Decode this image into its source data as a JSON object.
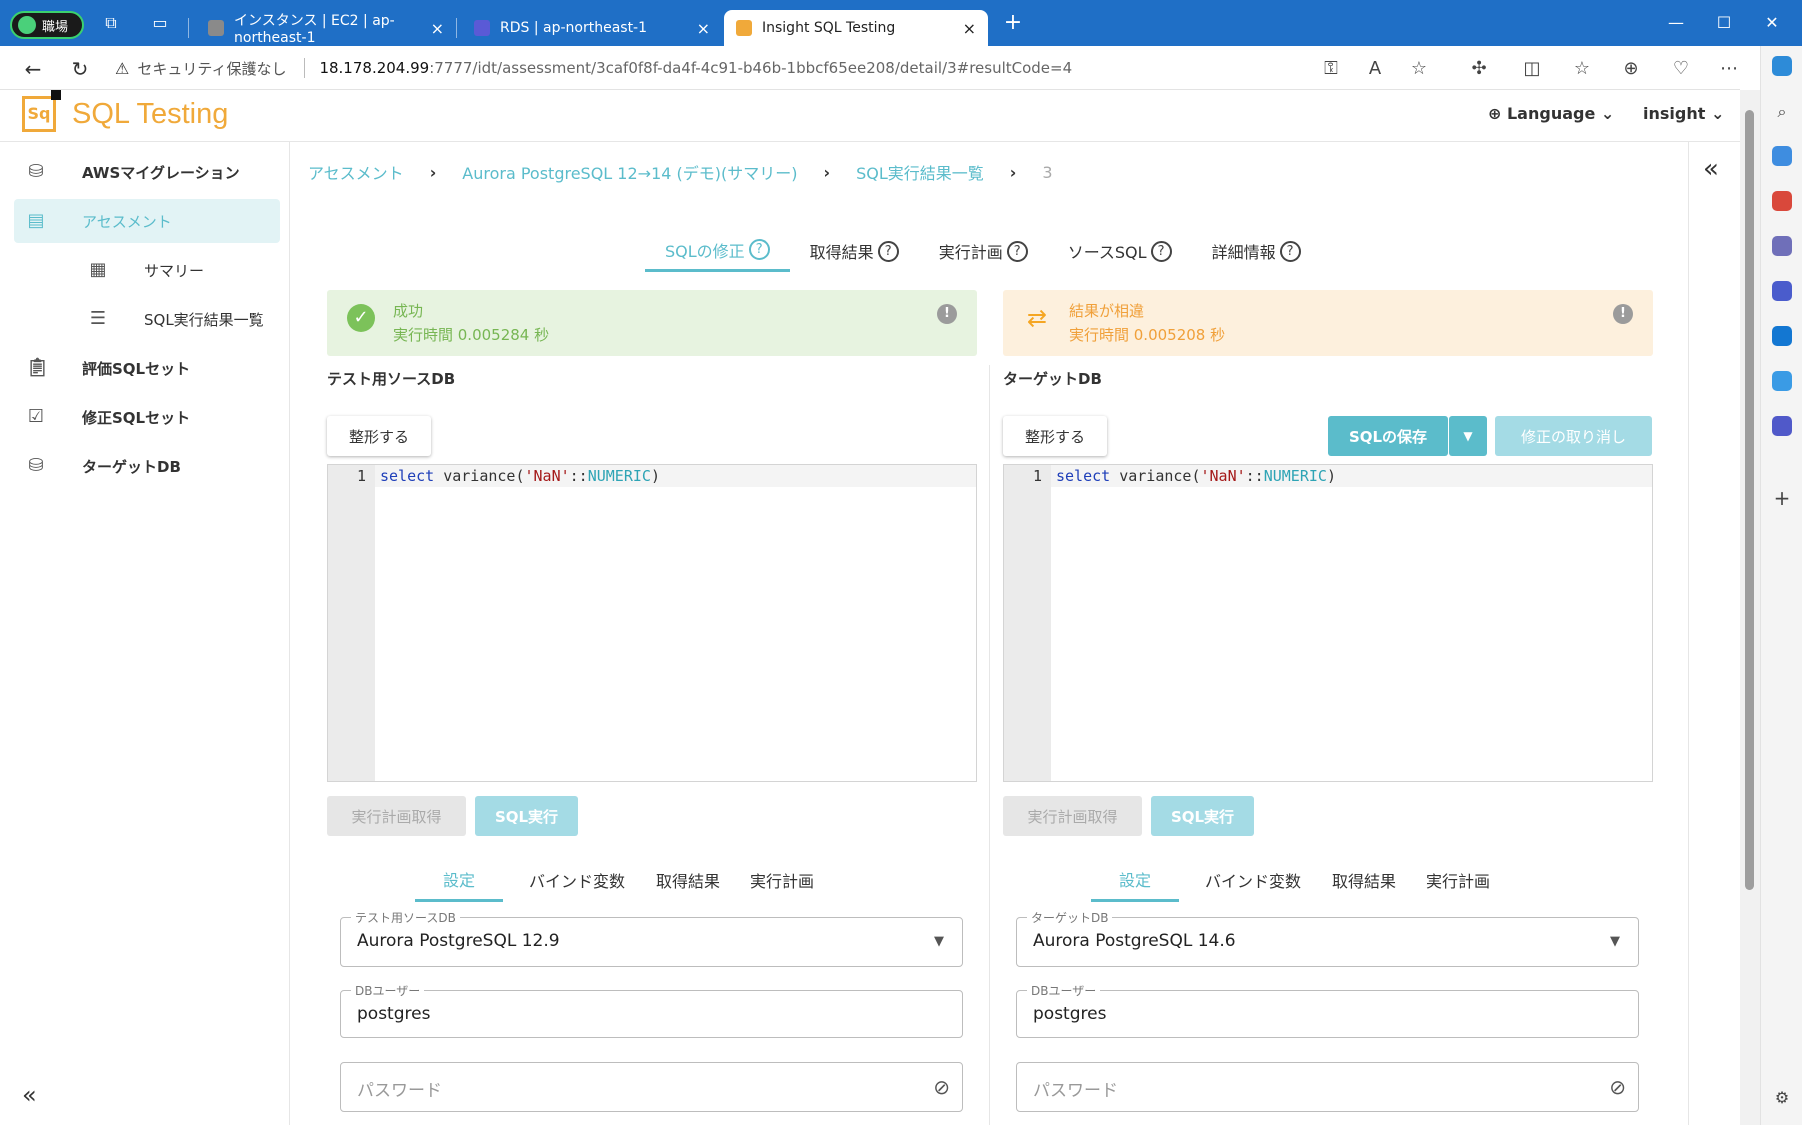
{
  "browser": {
    "profile_label": "職場",
    "tabs": [
      {
        "label": "インスタンス | EC2 | ap-northeast-1",
        "favicon": "#8a8a8a"
      },
      {
        "label": "RDS | ap-northeast-1",
        "favicon": "#5a5ad6"
      },
      {
        "label": "Insight SQL Testing",
        "favicon": "#f0a93a"
      }
    ],
    "tab_close": "×",
    "new_tab": "+",
    "url_warning": "セキュリティ保護なし",
    "url_host": "18.178.204.99",
    "url_path": ":7777/idt/assessment/3caf0f8f-da4f-4c91-b46b-1bbcf65ee208/detail/3#resultCode=4"
  },
  "app": {
    "logo_mark": "Sq",
    "title": "SQL Testing",
    "language_label": "Language",
    "user_label": "insight"
  },
  "sidebar": {
    "items": [
      {
        "label": "AWSマイグレーション"
      },
      {
        "label": "アセスメント"
      },
      {
        "label": "サマリー"
      },
      {
        "label": "SQL実行結果一覧"
      },
      {
        "label": "評価SQLセット"
      },
      {
        "label": "修正SQLセット"
      },
      {
        "label": "ターゲットDB"
      }
    ],
    "collapse": "«"
  },
  "right_rail": {
    "collapse": "«"
  },
  "breadcrumb": [
    "アセスメント",
    "Aurora PostgreSQL 12→14 (デモ)(サマリー)",
    "SQL実行結果一覧",
    "3"
  ],
  "main_tabs": [
    {
      "label": "SQLの修正"
    },
    {
      "label": "取得結果"
    },
    {
      "label": "実行計画"
    },
    {
      "label": "ソースSQL"
    },
    {
      "label": "詳細情報"
    }
  ],
  "left_panel": {
    "status_title": "成功",
    "status_time": "実行時間 0.005284 秒",
    "db_title": "テスト用ソースDB",
    "format_btn": "整形する",
    "line_no": "1",
    "code": {
      "kw": "select",
      "fn": " variance(",
      "str": "'NaN'",
      "op": "::",
      "type": "NUMERIC",
      "close": ")"
    },
    "plan_btn": "実行計画取得",
    "run_btn": "SQL実行",
    "sub_tabs": [
      "設定",
      "バインド変数",
      "取得結果",
      "実行計画"
    ],
    "db_field_label": "テスト用ソースDB",
    "db_field_value": "Aurora PostgreSQL 12.9",
    "user_field_label": "DBユーザー",
    "user_field_value": "postgres",
    "password_placeholder": "パスワード"
  },
  "right_panel": {
    "status_title": "結果が相違",
    "status_time": "実行時間 0.005208 秒",
    "db_title": "ターゲットDB",
    "format_btn": "整形する",
    "save_btn": "SQLの保存",
    "undo_btn": "修正の取り消し",
    "line_no": "1",
    "code": {
      "kw": "select",
      "fn": " variance(",
      "str": "'NaN'",
      "op": "::",
      "type": "NUMERIC",
      "close": ")"
    },
    "plan_btn": "実行計画取得",
    "run_btn": "SQL実行",
    "sub_tabs": [
      "設定",
      "バインド変数",
      "取得結果",
      "実行計画"
    ],
    "db_field_label": "ターゲットDB",
    "db_field_value": "Aurora PostgreSQL 14.6",
    "user_field_label": "DBユーザー",
    "user_field_value": "postgres",
    "password_placeholder": "パスワード"
  },
  "colors": {
    "accent": "#5bbccb",
    "brand": "#f0a93a",
    "success": "#77b653",
    "warning": "#f0a03a"
  }
}
